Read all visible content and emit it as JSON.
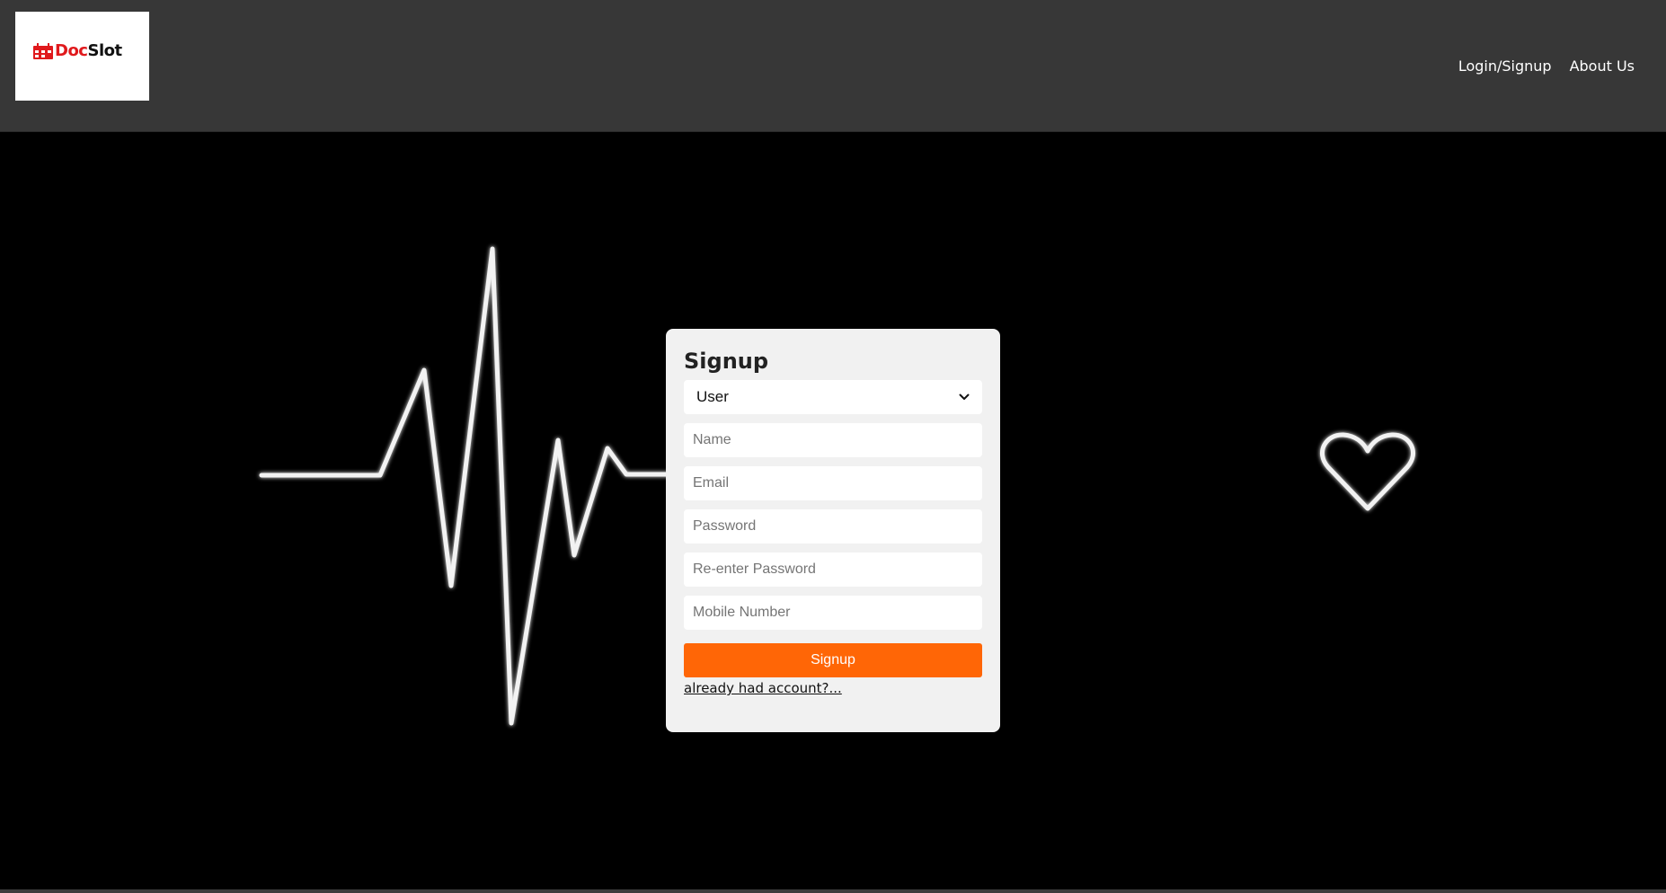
{
  "header": {
    "logo": {
      "text_doc": "Doc",
      "text_slot": "Slot"
    },
    "nav": [
      {
        "label": "Login/Signup"
      },
      {
        "label": "About Us"
      }
    ]
  },
  "signup_form": {
    "title": "Signup",
    "role_select": {
      "selected": "User"
    },
    "fields": {
      "name_placeholder": "Name",
      "email_placeholder": "Email",
      "password_placeholder": "Password",
      "reenter_password_placeholder": "Re-enter Password",
      "mobile_placeholder": "Mobile Number"
    },
    "submit_label": "Signup",
    "login_link": "already had account?..."
  },
  "colors": {
    "header_bg": "#373737",
    "hero_bg": "#000000",
    "card_bg": "#f1f1f1",
    "button_bg": "#ff6606",
    "logo_accent": "#e0191c"
  },
  "icons": [
    "calendar-icon",
    "chevron-down-icon",
    "heartbeat-line",
    "heart-outline-icon"
  ]
}
